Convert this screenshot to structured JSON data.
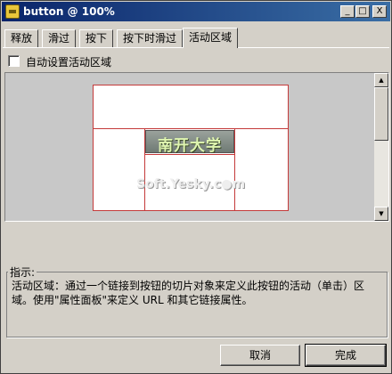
{
  "window": {
    "title": "button @ 100%"
  },
  "titlebar_buttons": {
    "minimize": "_",
    "maximize": "□",
    "close": "X"
  },
  "tabs": [
    {
      "label": "释放"
    },
    {
      "label": "滑过"
    },
    {
      "label": "按下"
    },
    {
      "label": "按下时滑过"
    },
    {
      "label": "活动区域",
      "active": true
    }
  ],
  "auto_area": {
    "label": "自动设置活动区域",
    "checked": false
  },
  "preview": {
    "button_text": "南开大学",
    "watermark": "Soft.Yesky.c●m"
  },
  "scroll": {
    "up": "▲",
    "down": "▼"
  },
  "hint": {
    "title": "指示:",
    "text": "活动区域：通过一个链接到按钮的切片对象来定义此按钮的活动（单击）区域。使用\"属性面板\"来定义 URL 和其它链接属性。"
  },
  "buttons": {
    "cancel": "取消",
    "ok": "完成"
  },
  "colors": {
    "title_bg": "#0a246a",
    "guide_line": "#c43a3a",
    "face": "#d4d0c8"
  }
}
